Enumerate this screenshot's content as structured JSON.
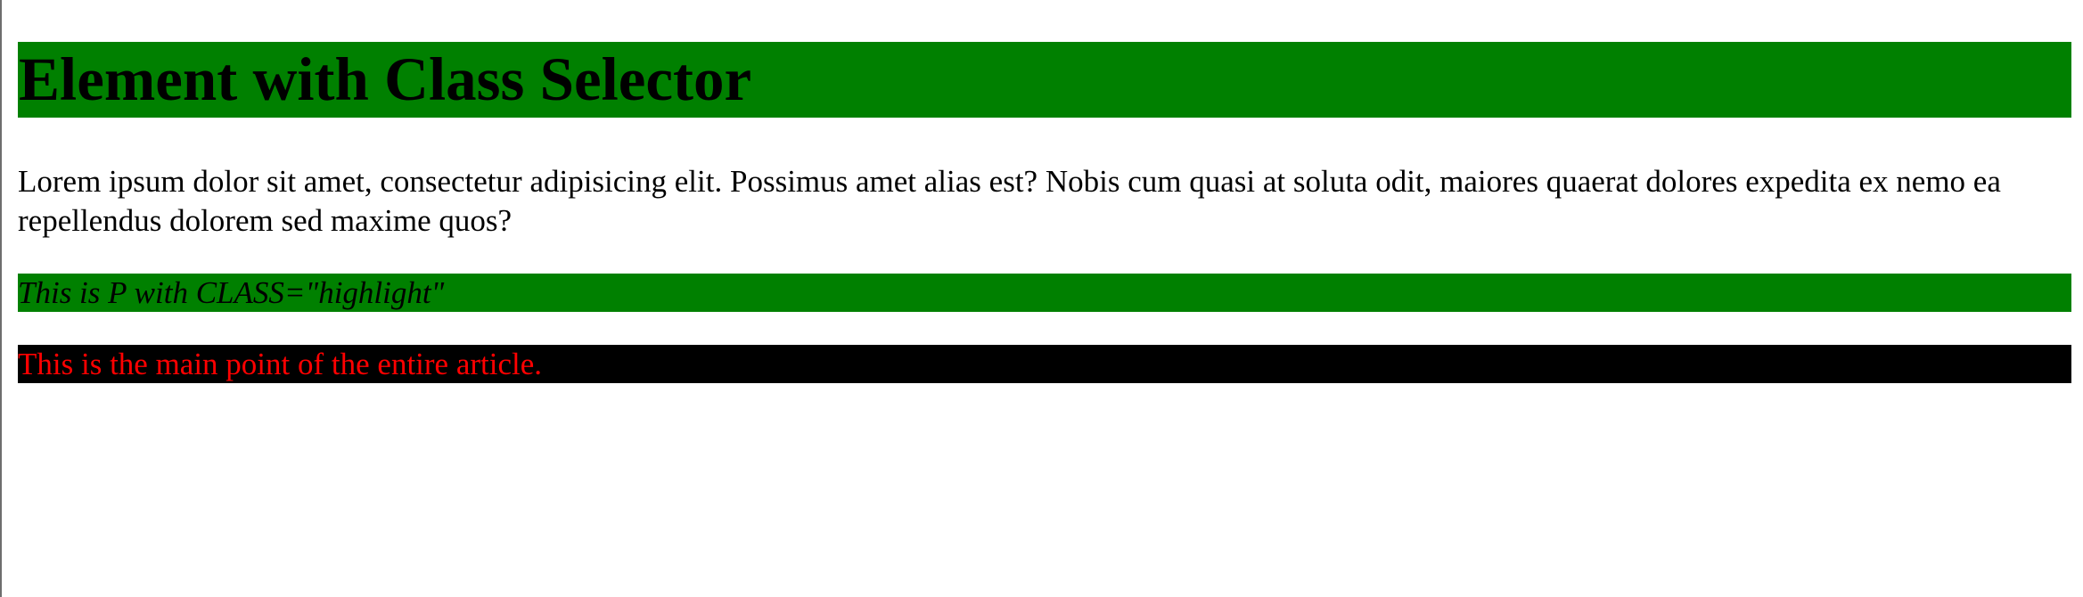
{
  "colors": {
    "highlight_bg": "#008000",
    "main_point_bg": "#000000",
    "main_point_text": "#ff0000",
    "text": "#000000",
    "page_bg": "#ffffff"
  },
  "heading": {
    "text": "Element with Class Selector"
  },
  "paragraph": {
    "text": "Lorem ipsum dolor sit amet, consectetur adipisicing elit. Possimus amet alias est? Nobis cum quasi at soluta odit, maiores quaerat dolores expedita ex nemo ea repellendus dolorem sed maxime quos?"
  },
  "highlight_paragraph": {
    "text": "This is P with CLASS=\"highlight\""
  },
  "main_point": {
    "text": "This is the main point of the entire article."
  }
}
